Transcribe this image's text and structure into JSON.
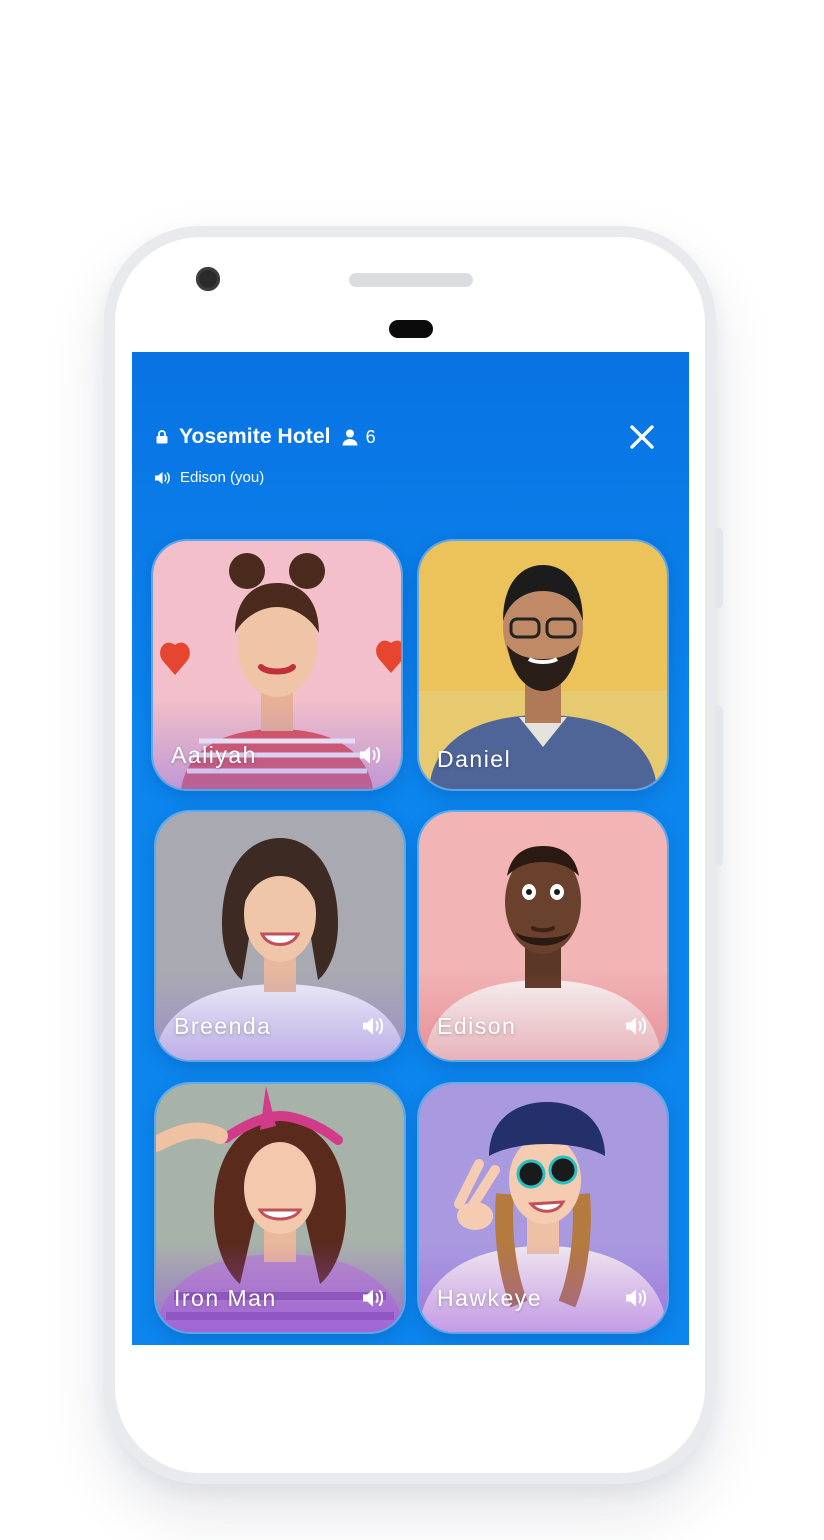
{
  "room": {
    "name": "Yosemite Hotel",
    "participant_count": "6",
    "speaking_label": "Edison (you)"
  },
  "icons": {
    "lock": "lock-icon",
    "person": "person-icon",
    "close": "close-icon",
    "speaker": "speaker-icon"
  },
  "colors": {
    "screen_top": "#0873e3",
    "screen_main": "#0c86ee"
  },
  "participants": [
    {
      "name": "Aaliyah",
      "background": "#f2bfca",
      "show_volume": true
    },
    {
      "name": "Daniel",
      "background": "#ecc35a",
      "show_volume": false
    },
    {
      "name": "Breenda",
      "background": "#a9aab1",
      "show_volume": true
    },
    {
      "name": "Edison",
      "background": "#f2b4b4",
      "show_volume": true
    },
    {
      "name": "Iron Man",
      "background": "#a7b2a9",
      "show_volume": true
    },
    {
      "name": "Hawkeye",
      "background": "#a99ae0",
      "show_volume": true
    }
  ]
}
